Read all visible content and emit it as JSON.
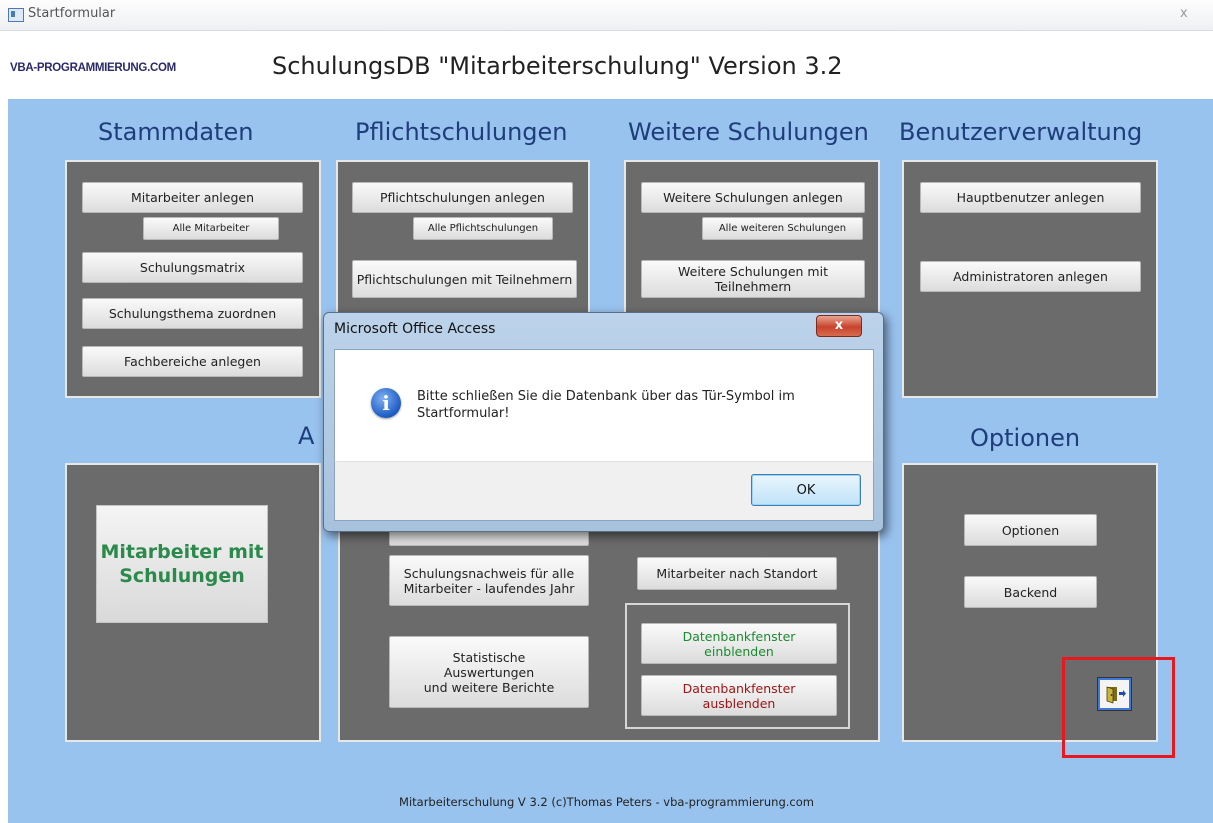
{
  "window": {
    "title": "Startformular",
    "close_glyph": "x"
  },
  "header": {
    "logo": "VBA-PROGRAMMIERUNG.COM",
    "title": "SchulungsDB \"Mitarbeiterschulung\" Version 3.2"
  },
  "sections": {
    "stammdaten": {
      "title": "Stammdaten",
      "buttons": {
        "mitarbeiter_anlegen": "Mitarbeiter anlegen",
        "alle_mitarbeiter": "Alle Mitarbeiter",
        "schulungsmatrix": "Schulungsmatrix",
        "schulungsthema": "Schulungsthema zuordnen",
        "fachbereiche": "Fachbereiche anlegen"
      }
    },
    "pflicht": {
      "title": "Pflichtschulungen",
      "buttons": {
        "anlegen": "Pflichtschulungen anlegen",
        "alle": "Alle Pflichtschulungen",
        "mit_teilnehmern": "Pflichtschulungen mit Teilnehmern"
      }
    },
    "weitere": {
      "title": "Weitere Schulungen",
      "buttons": {
        "anlegen": "Weitere Schulungen anlegen",
        "alle": "Alle weiteren Schulungen",
        "mit_teilnehmern": "Weitere Schulungen mit\nTeilnehmern"
      }
    },
    "benutzer": {
      "title": "Benutzerverwaltung",
      "buttons": {
        "hauptbenutzer": "Hauptbenutzer anlegen",
        "administratoren": "Administratoren anlegen"
      }
    },
    "auswertungen": {
      "title_partial": "A",
      "big_button": "Mitarbeiter mit\nSchulungen",
      "buttons": {
        "nachweis": "Schulungsnachweis für alle\nMitarbeiter - laufendes Jahr",
        "nach_standort": "Mitarbeiter nach Standort",
        "statistische": "Statistische\nAuswertungen\nund weitere Berichte",
        "einblenden": "Datenbankfenster\neinblenden",
        "ausblenden": "Datenbankfenster\nausblenden"
      }
    },
    "optionen": {
      "title": "Optionen",
      "buttons": {
        "optionen": "Optionen",
        "backend": "Backend"
      }
    }
  },
  "footer": "Mitarbeiterschulung V 3.2  (c)Thomas Peters - vba-programmierung.com",
  "dialog": {
    "title": "Microsoft Office Access",
    "close_glyph": "x",
    "icon": "info-icon",
    "message": "Bitte schließen Sie die Datenbank über das Tür-Symbol im Startformular!",
    "ok": "OK"
  },
  "colors": {
    "background": "#99c3ef",
    "section_title": "#1f3d7a",
    "panel": "#6b6b6b",
    "highlight": "#e8191e",
    "green_text": "#1c8a30",
    "red_text": "#9c1414"
  },
  "icons": {
    "door_exit": "door-exit-icon"
  }
}
